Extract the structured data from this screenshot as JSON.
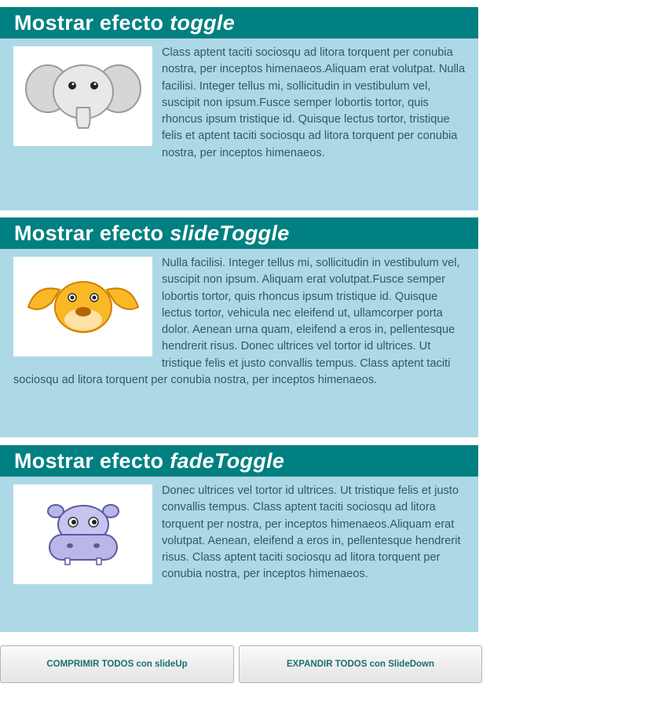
{
  "panels": [
    {
      "title_prefix": "Mostrar efecto",
      "effect": "toggle",
      "image_icon": "elephant-icon",
      "text": "Class aptent taciti sociosqu ad litora torquent per conubia nostra, per inceptos himenaeos.Aliquam erat volutpat. Nulla facilisi. Integer tellus mi, sollicitudin in vestibulum vel, suscipit non ipsum.Fusce semper lobortis tortor, quis rhoncus ipsum tristique id. Quisque lectus tortor, tristique felis et aptent taciti sociosqu ad litora torquent per conubia nostra, per inceptos himenaeos."
    },
    {
      "title_prefix": "Mostrar efecto",
      "effect": "slideToggle",
      "image_icon": "dog-icon",
      "text": "Nulla facilisi. Integer tellus mi, sollicitudin in vestibulum vel, suscipit non ipsum. Aliquam erat volutpat.Fusce semper lobortis tortor, quis rhoncus ipsum tristique id. Quisque lectus tortor, vehicula nec eleifend ut, ullamcorper porta dolor. Aenean urna quam, eleifend a eros in, pellentesque hendrerit risus. Donec ultrices vel tortor id ultrices. Ut tristique felis et justo convallis tempus. Class aptent taciti sociosqu ad litora torquent per conubia nostra, per inceptos himenaeos."
    },
    {
      "title_prefix": "Mostrar efecto",
      "effect": "fadeToggle",
      "image_icon": "hippo-icon",
      "text": "Donec ultrices vel tortor id ultrices. Ut tristique felis et justo convallis tempus. Class aptent taciti sociosqu ad litora torquent per nostra, per inceptos himenaeos.Aliquam erat volutpat. Aenean, eleifend a eros in, pellentesque hendrerit risus. Class aptent taciti sociosqu ad litora torquent per conubia nostra, per inceptos himenaeos."
    }
  ],
  "buttons": {
    "collapse_all": "COMPRIMIR TODOS con slideUp",
    "expand_all": "EXPANDIR TODOS con SlideDown"
  },
  "colors": {
    "header_bg": "#008080",
    "body_bg": "#add8e6",
    "body_text": "#2e5c5c",
    "button_text": "#1b6e6e"
  }
}
